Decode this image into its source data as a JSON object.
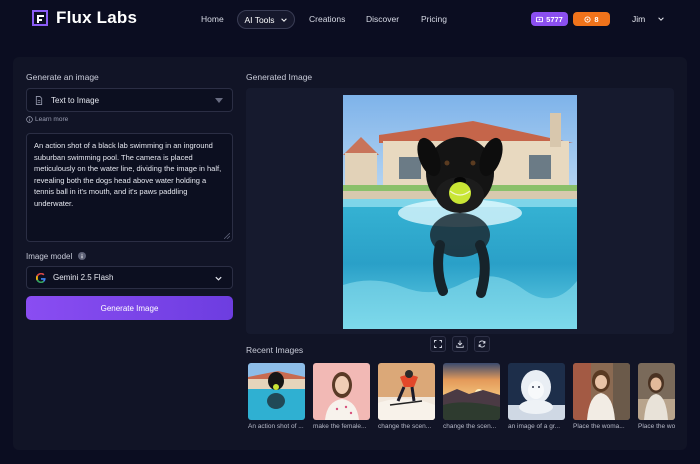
{
  "brand": {
    "name": "Flux Labs",
    "icon": "flux-logo-icon",
    "color": "#8b5cf6"
  },
  "nav": {
    "home": "Home",
    "ai_tools": "AI Tools",
    "creations": "Creations",
    "discover": "Discover",
    "pricing": "Pricing"
  },
  "account": {
    "credits": "5777",
    "credits_color": "#8b4ff0",
    "coins": "8",
    "coins_color": "#f0731b",
    "user_name": "Jim"
  },
  "left": {
    "title": "Generate an image",
    "mode_value": "Text to Image",
    "learn_more": "Learn more",
    "prompt": "An action shot of a black lab swimming in an inground suburban swimming pool. The camera is placed meticulously on the water line, dividing the image in half, revealing both the dogs head above water holding a tennis ball in it's mouth, and it's paws paddling underwater.",
    "model_label": "Image model",
    "model_value": "Gemini 2.5 Flash",
    "generate_button": "Generate Image"
  },
  "right": {
    "title": "Generated Image",
    "tools": [
      "expand-icon",
      "download-icon",
      "regenerate-icon"
    ],
    "recent_title": "Recent Images",
    "recent": [
      {
        "caption": "An action shot of ...",
        "icon": "dog-pool-thumbnail"
      },
      {
        "caption": "make the female...",
        "icon": "woman-portrait-thumbnail"
      },
      {
        "caption": "change the scen...",
        "icon": "skier-thumbnail"
      },
      {
        "caption": "change the scen...",
        "icon": "sunset-landscape-thumbnail"
      },
      {
        "caption": "an image of a gr...",
        "icon": "white-lion-thumbnail"
      },
      {
        "caption": "Place the woma...",
        "icon": "woman-street-thumbnail"
      },
      {
        "caption": "Place the wo",
        "icon": "woman-seated-thumbnail"
      }
    ]
  }
}
